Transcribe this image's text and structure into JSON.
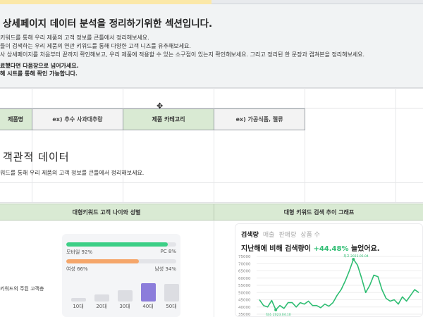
{
  "intro": {
    "title": "상세페이지 데이터 분석을 정리하기위한 섹션입니다.",
    "lines": [
      "키워드를 통해 우리 제품의 고객 정보를 큰틀에서 정리해보세요.",
      "들이 검색하는 우리 제품의 연관 키워드를 통해 다양한 고객 니즈를 유추해보세요.",
      "사 상세페이지를 처음부터 끝까지 확인해보고, 우리 제품에 적용할 수 있는 소구점이 있는지 확인해보세요. 그리고 정리된 한 문장과 캡쳐본을 정리해보세요."
    ],
    "bold_lines": [
      "료했다면 다음장으로 넘어가세요.",
      "해 시트를 통해 확인 가능합니다."
    ]
  },
  "header_row": {
    "cells": [
      {
        "text": "제품명",
        "style": "green"
      },
      {
        "text": "ex) 추수 사과대추랑",
        "style": "gray"
      },
      {
        "text": "제품 카테고리",
        "style": "green"
      },
      {
        "text": "ex) 가공식품, 젤류",
        "style": "gray"
      }
    ]
  },
  "section": {
    "title": "객관적 데이터",
    "desc": "워드를 통해 우리 제품의 고객 정보를 큰틀에서 정리해보세요."
  },
  "bands": {
    "left": "대형키워드 고객 나이와 성별",
    "right": "대형 키워드 검색 추이 그래프"
  },
  "left_label": "키워드의 주된 고객층",
  "device": {
    "mobile_label": "모바일 92%",
    "pc_label": "PC 8%",
    "mobile_pct": 92,
    "color": "#3ccf86"
  },
  "gender": {
    "female_label": "여성 66%",
    "male_label": "남성 34%",
    "female_pct": 66,
    "color": "#f5a66a"
  },
  "ages": {
    "labels": [
      "10대",
      "20대",
      "30대",
      "40대",
      "50대"
    ],
    "levels": [
      0.2,
      0.38,
      0.62,
      1.0,
      0.95
    ],
    "highlight_index": 3,
    "highlight_color": "#8c7ddb",
    "base_color": "#dcdde2"
  },
  "search_card": {
    "tabs": [
      "검색량",
      "매출",
      "판매량",
      "상품 수"
    ],
    "active_tab": 0,
    "summary_prefix": "지난해에 비해 검색량이",
    "summary_pct": "+44.48%",
    "summary_suffix": "늘었어요.",
    "peak_label": "최고 2023.05.04",
    "low_label": "최소 2023.04.10"
  },
  "chart_data": {
    "type": "line",
    "y_ticks": [
      "75000",
      "70000",
      "65000",
      "60000",
      "55000",
      "50000",
      "45000",
      "40000",
      "35000"
    ],
    "ylim": [
      35000,
      75000
    ],
    "values": [
      45000,
      41000,
      40000,
      44500,
      38000,
      41000,
      39000,
      43000,
      43000,
      40000,
      43000,
      42000,
      44000,
      41000,
      41000,
      39500,
      42000,
      40500,
      43000,
      48000,
      52000,
      58000,
      65000,
      73000,
      69000,
      60000,
      50000,
      55000,
      62000,
      61000,
      52000,
      46000,
      44000,
      45000,
      42000,
      47000,
      44000,
      48000,
      52000,
      50000
    ],
    "line_color": "#2ebd72",
    "peak_index": 23,
    "low_index": 4
  }
}
